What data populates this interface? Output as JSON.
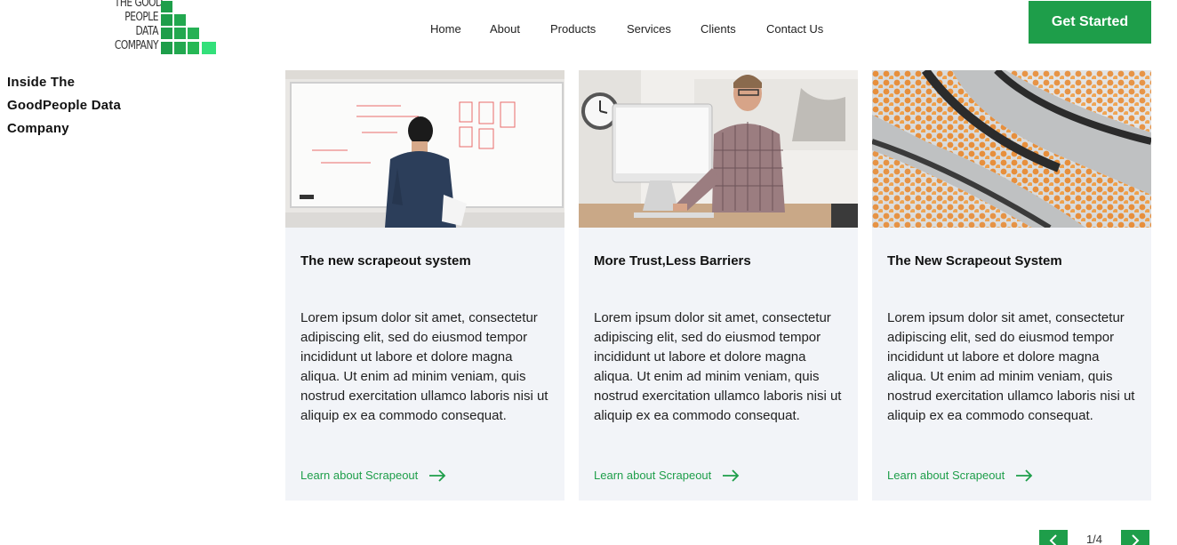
{
  "brand": {
    "logo_lines": [
      "THE GOOD",
      "PEOPLE",
      "DATA",
      "COMPANY"
    ],
    "accent_color": "#1e9e4a"
  },
  "nav": {
    "items": [
      "Home",
      "About",
      "Products",
      "Services",
      "Clients",
      "Contact Us"
    ]
  },
  "header": {
    "cta_label": "Get Started"
  },
  "section": {
    "title": "Inside The GoodPeople Data Company"
  },
  "cards": [
    {
      "title": "The new scrapeout system",
      "body": "Lorem ipsum dolor sit amet, consectetur adipiscing elit, sed do eiusmod tempor incididunt ut labore et dolore magna aliqua. Ut enim ad minim veniam, quis nostrud exercitation ullamco laboris nisi ut aliquip ex ea commodo consequat.",
      "link": "Learn about Scrapeout",
      "image": "person-at-whiteboard"
    },
    {
      "title": "More Trust,Less Barriers",
      "body": "Lorem ipsum dolor sit amet, consectetur adipiscing elit, sed do eiusmod tempor incididunt ut labore et dolore magna aliqua. Ut enim ad minim veniam, quis nostrud exercitation ullamco laboris nisi ut aliquip ex ea commodo consequat.",
      "link": "Learn about Scrapeout",
      "image": "man-at-computer"
    },
    {
      "title": "The New Scrapeout System",
      "body": "Lorem ipsum dolor sit amet, consectetur adipiscing elit, sed do eiusmod tempor incididunt ut labore et dolore magna aliqua. Ut enim ad minim veniam, quis nostrud exercitation ullamco laboris nisi ut aliquip ex ea commodo consequat.",
      "link": "Learn about Scrapeout",
      "image": "oranges-on-conveyor"
    }
  ],
  "pager": {
    "label": "1/4",
    "prev_icon": "chevron-left-icon",
    "next_icon": "chevron-right-icon"
  }
}
